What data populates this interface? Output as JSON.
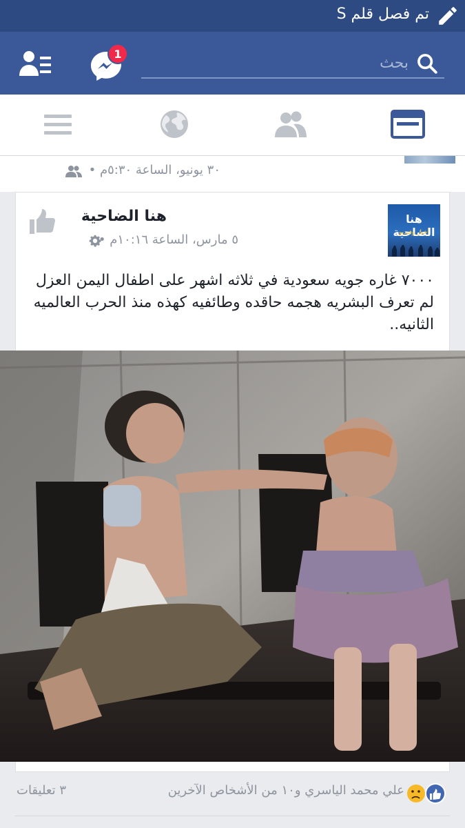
{
  "status_bar": {
    "text": "تم فصل قلم S",
    "icon": "pencil-icon"
  },
  "app_bar": {
    "search_placeholder": "بحث",
    "messenger_badge": "1",
    "icons": [
      "search-icon",
      "messenger-icon",
      "friend-requests-icon"
    ]
  },
  "tabs": [
    {
      "name": "news-feed",
      "icon": "news-feed-icon",
      "active": true
    },
    {
      "name": "friends",
      "icon": "friends-icon",
      "active": false
    },
    {
      "name": "globe",
      "icon": "globe-icon",
      "active": false
    },
    {
      "name": "menu",
      "icon": "menu-icon",
      "active": false
    }
  ],
  "previous_post": {
    "meta": "٣٠ يونيو، الساعة ٥:٣٠م •"
  },
  "post": {
    "avatar_title": "هنا الضاحية",
    "avatar_subtitle": "أخبار وفيديو",
    "page_name": "هنا الضاحية",
    "meta": "٥ مارس، الساعة ١٠:١٦م •",
    "text_lines": [
      "٧٠٠٠ غاره جويه سعودية في ثلاثه اشهر على اطفال اليمن العزل",
      "لم تعرف البشريه هجمه حاقده وطائفيه كهذه منذ الحرب العالميه",
      "الثانيه.."
    ]
  },
  "reactions": {
    "names": "علي محمد الياسري و١٠ من الأشخاص الآخرين",
    "comments": "٣ تعليقات",
    "icons": [
      "like-reaction-icon",
      "sad-reaction-icon"
    ]
  },
  "colors": {
    "brand": "#3b5998",
    "status_bar": "#2d4a82",
    "badge": "#f02849",
    "muted": "#8d949e"
  }
}
